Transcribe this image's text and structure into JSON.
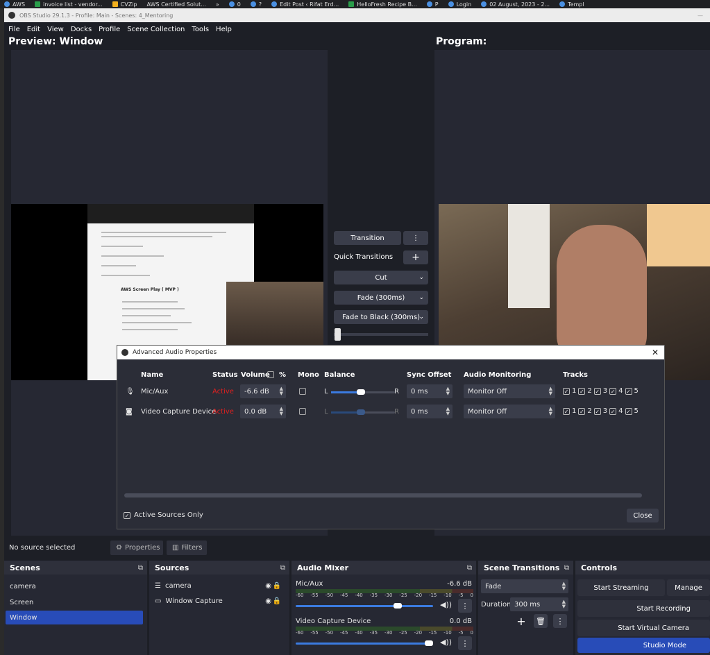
{
  "browser_bookmarks": [
    "AWS",
    "invoice list - vendor...",
    "CVZip",
    "AWS Certified Solut...",
    "»",
    "0",
    "?",
    "Edit Post ‹ Rifat Erd...",
    "HelloFresh Recipe B...",
    "P",
    "Login",
    "02 August, 2023 - 2...",
    "Templ"
  ],
  "window": {
    "title": "OBS Studio 29.1.3 - Profile: Main - Scenes: 4_Mentoring",
    "minimize": "—"
  },
  "menu": [
    "File",
    "Edit",
    "View",
    "Docks",
    "Profile",
    "Scene Collection",
    "Tools",
    "Help"
  ],
  "preview": {
    "label": "Preview: Window"
  },
  "program": {
    "label": "Program:"
  },
  "preview_doc": {
    "heading": "AWS Screen Play ( MVP )"
  },
  "transitions_panel": {
    "transition_button": "Transition",
    "quick_transitions_label": "Quick Transitions",
    "items": [
      "Cut",
      "Fade (300ms)",
      "Fade to Black (300ms)"
    ]
  },
  "advanced_audio": {
    "title": "Advanced Audio Properties",
    "close_glyph": "✕",
    "headers": {
      "name": "Name",
      "status": "Status",
      "volume": "Volume",
      "percent": "%",
      "mono": "Mono",
      "balance": "Balance",
      "sync_offset": "Sync Offset",
      "audio_monitoring": "Audio Monitoring",
      "tracks": "Tracks"
    },
    "rows": [
      {
        "name": "Mic/Aux",
        "status": "Active",
        "volume": "-6.6 dB",
        "balance_left": "L",
        "balance_right": "R",
        "sync_offset": "0 ms",
        "monitoring": "Monitor Off",
        "tracks": [
          "1",
          "2",
          "3",
          "4",
          "5"
        ]
      },
      {
        "name": "Video Capture Device",
        "status": "Active",
        "volume": "0.0 dB",
        "balance_left": "L",
        "balance_right": "R",
        "sync_offset": "0 ms",
        "monitoring": "Monitor Off",
        "tracks": [
          "1",
          "2",
          "3",
          "4",
          "5"
        ]
      }
    ],
    "active_sources_only": "Active Sources Only",
    "close_button": "Close"
  },
  "source_bar": {
    "status": "No source selected",
    "properties": "Properties",
    "filters": "Filters"
  },
  "scenes": {
    "title": "Scenes",
    "items": [
      "camera",
      "Screen",
      "Window"
    ],
    "selected": "Window"
  },
  "sources": {
    "title": "Sources",
    "items": [
      "camera",
      "Window Capture"
    ]
  },
  "audio_mixer": {
    "title": "Audio Mixer",
    "tick_labels": [
      "-60",
      "-55",
      "-50",
      "-45",
      "-40",
      "-35",
      "-30",
      "-25",
      "-20",
      "-15",
      "-10",
      "-5",
      "0"
    ],
    "channels": [
      {
        "name": "Mic/Aux",
        "level": "-6.6 dB",
        "fader_fraction": 0.76
      },
      {
        "name": "Video Capture Device",
        "level": "0.0 dB",
        "fader_fraction": 1.0
      }
    ]
  },
  "scene_transitions": {
    "title": "Scene Transitions",
    "selected": "Fade",
    "duration_label": "Duration",
    "duration_value": "300 ms"
  },
  "controls": {
    "title": "Controls",
    "start_streaming": "Start Streaming",
    "manage": "Manage",
    "start_recording": "Start Recording",
    "start_virtual_camera": "Start Virtual Camera",
    "studio_mode": "Studio Mode"
  },
  "colors": {
    "accent": "#284cb8",
    "active_status": "#e02020",
    "panel_bg": "#262833"
  }
}
